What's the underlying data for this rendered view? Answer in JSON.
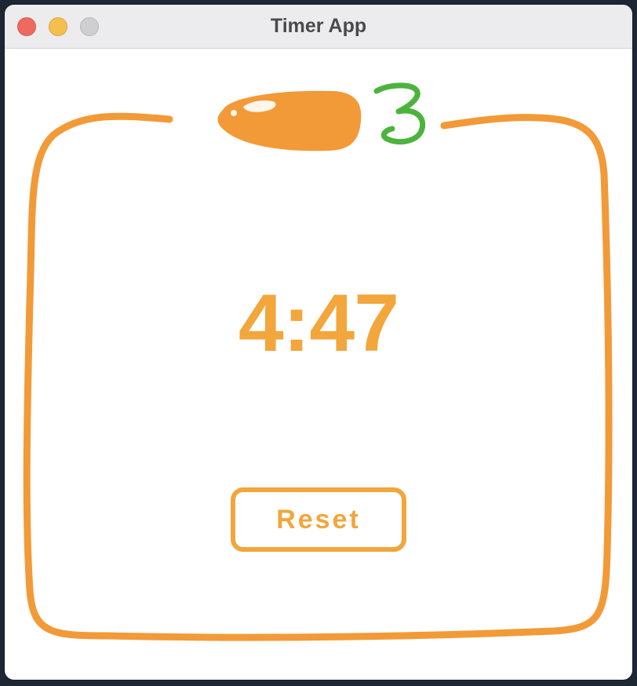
{
  "window": {
    "title": "Timer App"
  },
  "timer": {
    "display": "4:47",
    "count_badge": "3"
  },
  "controls": {
    "reset_label": "Reset"
  },
  "colors": {
    "accent_orange": "#f29a38",
    "timer_text": "#f2a63c",
    "badge_green": "#4cb43c",
    "window_background": "#ffffff",
    "titlebar": "#ececee"
  },
  "icons": {
    "indicator": "pill-shaped-orange-indicator-icon",
    "frame": "hand-drawn-rounded-frame"
  }
}
